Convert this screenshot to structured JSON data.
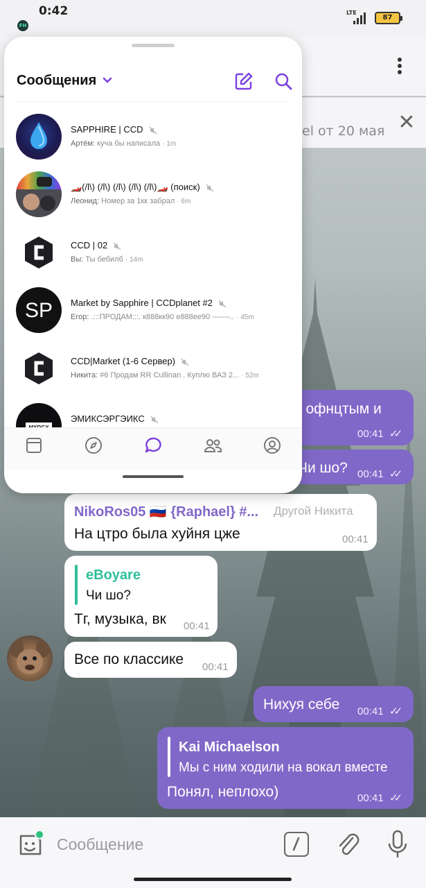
{
  "status_bar": {
    "time": "0:42",
    "network": "LTE",
    "battery": "87",
    "app_icon": "FH"
  },
  "chat_header": {
    "more_icon": "more-vertical-icon"
  },
  "pinned": {
    "text": "el от 20 мая",
    "close_icon": "close-icon"
  },
  "messages": [
    {
      "id": "m1",
      "direction": "out",
      "text": "т офнцтым и",
      "time": "00:41",
      "read": true
    },
    {
      "id": "m2",
      "direction": "out",
      "text": "Чи шо?",
      "time": "00:41",
      "read": true
    },
    {
      "id": "m3",
      "direction": "in",
      "sender": "NikoRos05 🇷🇺 {Raphael} #...",
      "sender_role": "Другой Никита",
      "text": "На цтро была хуйня цже",
      "time": "00:41"
    },
    {
      "id": "m4",
      "direction": "in",
      "reply_name": "eBoyare",
      "reply_text": "Чи шо?",
      "text": "Тг, музыка, вк",
      "time": "00:41"
    },
    {
      "id": "m5",
      "direction": "in",
      "text": "Все по классике",
      "time": "00:41"
    },
    {
      "id": "m6",
      "direction": "out",
      "text": "Нихуя себе",
      "time": "00:41",
      "read": true
    },
    {
      "id": "m7",
      "direction": "out",
      "reply_name": "Kai Michaelson",
      "reply_text": "Мы с ним ходили на вокал вместе",
      "text": "Понял, неплохо)",
      "time": "00:41",
      "read": true
    }
  ],
  "input": {
    "placeholder": "Сообщение"
  },
  "panel": {
    "title": "Сообщения",
    "chats": [
      {
        "name": "SAPPHIRE | CCD",
        "author": "Артём:",
        "preview": "куча бы написала",
        "ago": "· 1m",
        "muted": true
      },
      {
        "name": "🏎️(/l\\) (/l\\) (/l\\) (/l\\) (/l\\)🏎️ (поиск)",
        "author": "Леонид:",
        "preview": "Номер за 1кк забрал",
        "ago": "· 6m",
        "muted": true
      },
      {
        "name": "CCD | 02",
        "author": "Вы:",
        "preview": "Ты бебилб",
        "ago": "· 14m",
        "muted": true
      },
      {
        "name": "Market by Sapphire | CCDplanet #2",
        "author": "Егор:",
        "preview": ".:::ПРОДАМ:::.  к888кк90  е888ее90  -------..",
        "ago": "· 45m",
        "muted": true
      },
      {
        "name": "CCD|Market (1-6 Сервер)",
        "author": "Никита:",
        "preview": "#6 Продам RR Cullinan .  Куплю ВАЗ 2...",
        "ago": "· 52m",
        "muted": true
      },
      {
        "name": "ЭМИКСЭРГЭИКС",
        "author": "",
        "preview": "",
        "ago": "",
        "muted": true
      }
    ],
    "tabs": [
      "feed-icon",
      "explore-icon",
      "chats-icon",
      "contacts-icon",
      "profile-icon"
    ]
  },
  "colors": {
    "accent": "#8068c8",
    "outgoing": "#8068c8",
    "incoming": "#ffffff",
    "panel_accent": "#7b3fe0"
  }
}
